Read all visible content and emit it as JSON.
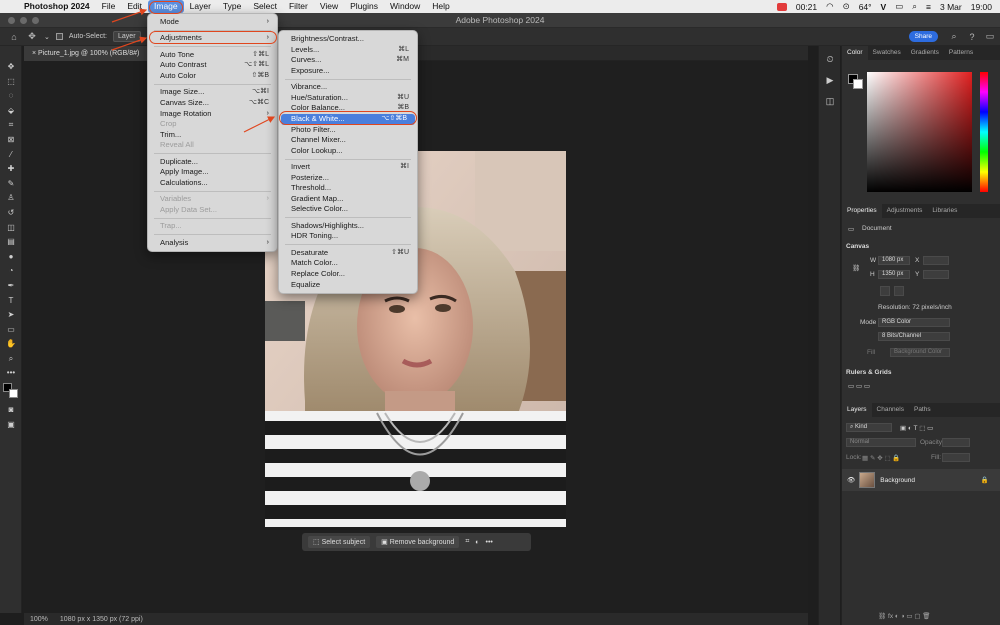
{
  "menubar": {
    "app_name": "Photoshop 2024",
    "items": [
      "File",
      "Edit",
      "Image",
      "Layer",
      "Type",
      "Select",
      "Filter",
      "View",
      "Plugins",
      "Window",
      "Help"
    ],
    "time_timer": "00:21",
    "temperature": "64°",
    "date": "3 Mar",
    "clock": "19:00"
  },
  "titlebar": {
    "title": "Adobe Photoshop 2024"
  },
  "options": {
    "auto_select": "Auto-Select:",
    "layer_select": "Layer",
    "share_label": "Share"
  },
  "document": {
    "tab": "Picture_1.jpg @ 100% (RGB/8#)"
  },
  "status": {
    "zoom": "100%",
    "size": "1080 px x 1350 px (72 ppi)"
  },
  "taskbar": {
    "select_subject": "Select subject",
    "remove_background": "Remove background",
    "more": "•••"
  },
  "image_menu": {
    "rows": [
      {
        "label": "Mode",
        "shortcut": "",
        "submenu": true,
        "disabled": false
      },
      {
        "sep": true
      },
      {
        "label": "Adjustments",
        "shortcut": "",
        "submenu": true,
        "disabled": false
      },
      {
        "sep": true
      },
      {
        "label": "Auto Tone",
        "shortcut": "⇧⌘L",
        "submenu": false,
        "disabled": false
      },
      {
        "label": "Auto Contrast",
        "shortcut": "⌥⇧⌘L",
        "submenu": false,
        "disabled": false
      },
      {
        "label": "Auto Color",
        "shortcut": "⇧⌘B",
        "submenu": false,
        "disabled": false
      },
      {
        "sep": true
      },
      {
        "label": "Image Size...",
        "shortcut": "⌥⌘I",
        "submenu": false,
        "disabled": false
      },
      {
        "label": "Canvas Size...",
        "shortcut": "⌥⌘C",
        "submenu": false,
        "disabled": false
      },
      {
        "label": "Image Rotation",
        "shortcut": "",
        "submenu": true,
        "disabled": false
      },
      {
        "label": "Crop",
        "shortcut": "",
        "submenu": false,
        "disabled": true
      },
      {
        "label": "Trim...",
        "shortcut": "",
        "submenu": false,
        "disabled": false
      },
      {
        "label": "Reveal All",
        "shortcut": "",
        "submenu": false,
        "disabled": true
      },
      {
        "sep": true
      },
      {
        "label": "Duplicate...",
        "shortcut": "",
        "submenu": false,
        "disabled": false
      },
      {
        "label": "Apply Image...",
        "shortcut": "",
        "submenu": false,
        "disabled": false
      },
      {
        "label": "Calculations...",
        "shortcut": "",
        "submenu": false,
        "disabled": false
      },
      {
        "sep": true
      },
      {
        "label": "Variables",
        "shortcut": "",
        "submenu": true,
        "disabled": true
      },
      {
        "label": "Apply Data Set...",
        "shortcut": "",
        "submenu": false,
        "disabled": true
      },
      {
        "sep": true
      },
      {
        "label": "Trap...",
        "shortcut": "",
        "submenu": false,
        "disabled": true
      },
      {
        "sep": true
      },
      {
        "label": "Analysis",
        "shortcut": "",
        "submenu": true,
        "disabled": false
      }
    ]
  },
  "adjust_menu": {
    "rows": [
      {
        "label": "Brightness/Contrast...",
        "shortcut": ""
      },
      {
        "label": "Levels...",
        "shortcut": "⌘L"
      },
      {
        "label": "Curves...",
        "shortcut": "⌘M"
      },
      {
        "label": "Exposure...",
        "shortcut": ""
      },
      {
        "sep": true
      },
      {
        "label": "Vibrance...",
        "shortcut": ""
      },
      {
        "label": "Hue/Saturation...",
        "shortcut": "⌘U"
      },
      {
        "label": "Color Balance...",
        "shortcut": "⌘B"
      },
      {
        "label": "Black & White...",
        "shortcut": "⌥⇧⌘B",
        "highlight": true
      },
      {
        "label": "Photo Filter...",
        "shortcut": ""
      },
      {
        "label": "Channel Mixer...",
        "shortcut": ""
      },
      {
        "label": "Color Lookup...",
        "shortcut": ""
      },
      {
        "sep": true
      },
      {
        "label": "Invert",
        "shortcut": "⌘I"
      },
      {
        "label": "Posterize...",
        "shortcut": ""
      },
      {
        "label": "Threshold...",
        "shortcut": ""
      },
      {
        "label": "Gradient Map...",
        "shortcut": ""
      },
      {
        "label": "Selective Color...",
        "shortcut": ""
      },
      {
        "sep": true
      },
      {
        "label": "Shadows/Highlights...",
        "shortcut": ""
      },
      {
        "label": "HDR Toning...",
        "shortcut": ""
      },
      {
        "sep": true
      },
      {
        "label": "Desaturate",
        "shortcut": "⇧⌘U"
      },
      {
        "label": "Match Color...",
        "shortcut": ""
      },
      {
        "label": "Replace Color...",
        "shortcut": ""
      },
      {
        "label": "Equalize",
        "shortcut": ""
      }
    ]
  },
  "color_panel": {
    "tabs": [
      "Color",
      "Swatches",
      "Gradients",
      "Patterns"
    ]
  },
  "properties_panel": {
    "tabs": [
      "Properties",
      "Adjustments",
      "Libraries"
    ],
    "document_label": "Document",
    "canvas_label": "Canvas",
    "w_label": "W",
    "w_value": "1080 px",
    "h_label": "H",
    "h_value": "1350 px",
    "x_label": "X",
    "y_label": "Y",
    "resolution": "Resolution: 72 pixels/inch",
    "mode_label": "Mode",
    "mode_value": "RGB Color",
    "bits_value": "8 Bits/Channel",
    "fill_label": "Fill",
    "fill_value": "Background Color",
    "rulers_label": "Rulers & Grids"
  },
  "layers_panel": {
    "tabs": [
      "Layers",
      "Channels",
      "Paths"
    ],
    "kind_label": "Kind",
    "blend_mode": "Normal",
    "opacity_label": "Opacity:",
    "lock_label": "Lock:",
    "fill_label": "Fill:",
    "layer_name": "Background"
  },
  "colors": {
    "accent": "#2d6cdf",
    "highlight": "#4a7fdc",
    "annotation": "#e0461e"
  }
}
